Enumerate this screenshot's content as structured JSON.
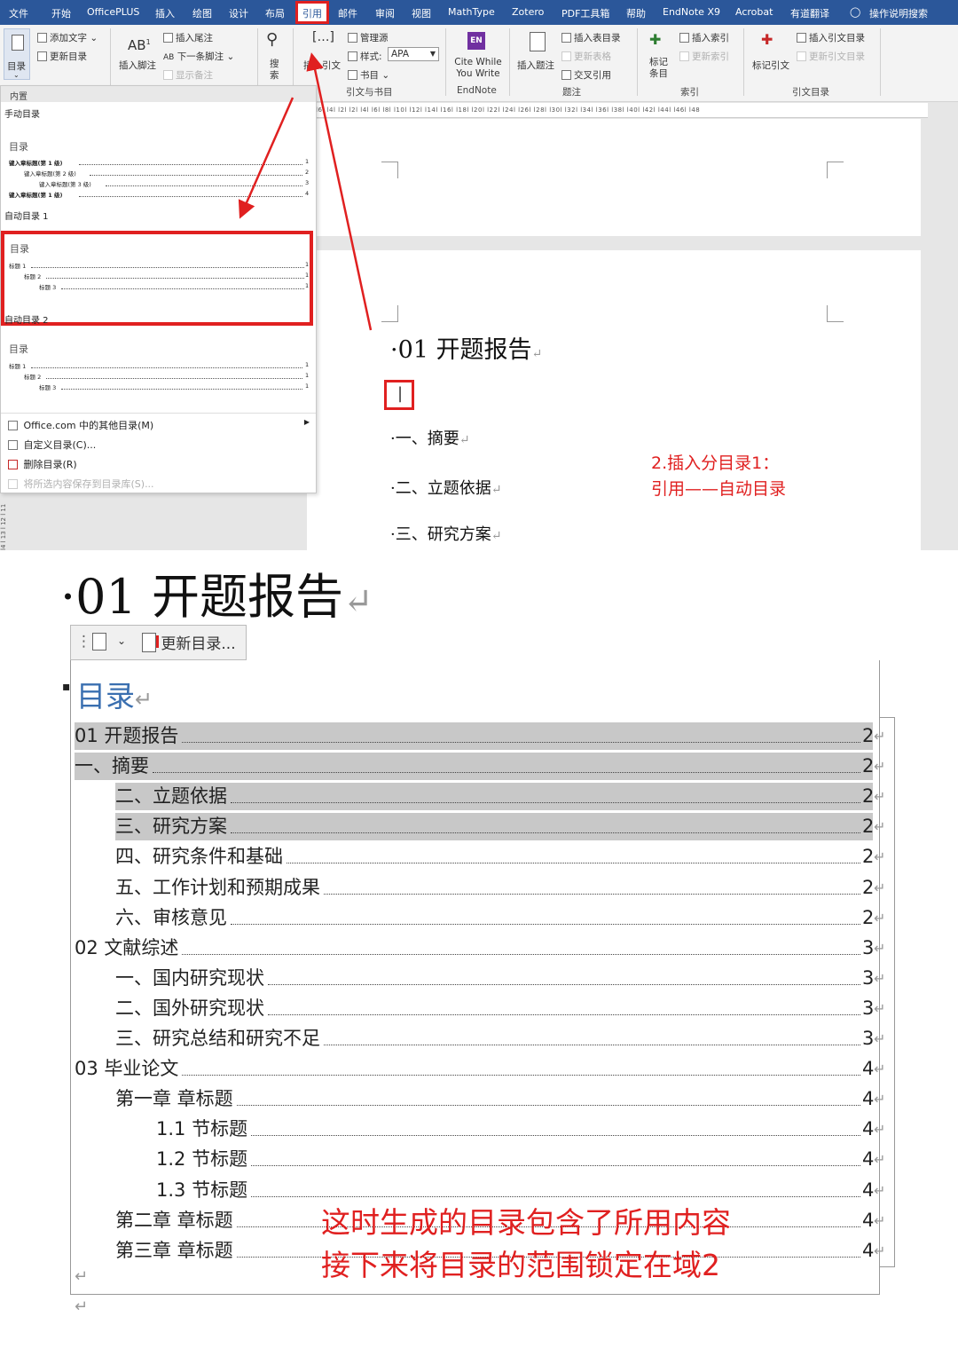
{
  "menubar": {
    "tabs": [
      "文件",
      "开始",
      "OfficePLUS",
      "插入",
      "绘图",
      "设计",
      "布局",
      "引用",
      "邮件",
      "审阅",
      "视图",
      "MathType",
      "Zotero",
      "PDF工具箱",
      "帮助",
      "EndNote X9",
      "Acrobat",
      "有道翻译",
      "操作说明搜索"
    ]
  },
  "ribbon": {
    "toc_button": "目录",
    "add_text": "添加文字",
    "update_toc": "更新目录",
    "insert_footnote": "插入脚注",
    "insert_endnote": "插入尾注",
    "next_footnote": "下一条脚注",
    "show_notes": "显示备注",
    "search": "搜索",
    "insert_citation": "插入引文",
    "manage_sources": "管理源",
    "style_label": "样式:",
    "style_value": "APA",
    "bibliography": "书目",
    "group_citations": "引文与书目",
    "cite_while_you_write": "Cite While You Write",
    "endnote_icon": "EN",
    "group_endnote": "EndNote",
    "insert_caption": "插入题注",
    "insert_table_of_figures": "插入表目录",
    "update_table": "更新表格",
    "cross_reference": "交叉引用",
    "group_captions": "题注",
    "mark_entry": "标记条目",
    "insert_index": "插入索引",
    "update_index": "更新索引",
    "group_index": "索引",
    "mark_citation": "标记引文",
    "insert_table_of_authorities": "插入引文目录",
    "update_table_of_authorities": "更新引文目录",
    "group_authorities": "引文目录"
  },
  "ruler_text": "l6l  l4l  l2l   l2l  l4l  l6l  l8l  l10l  l12l  l14l  l16l  l18l  l20l  l22l  l24l  l26l  l28l  l30l  l32l  l34l  l36l  l38l  l40l  l42l  l44l  l46l  l48",
  "vruler_text": "l4 l 13 l 12 l 11",
  "dropdown": {
    "header": "内置",
    "manual_label": "手动目录",
    "manual_title": "目录",
    "manual_lines": [
      "键入章标题(第 1 级)",
      "键入章标题(第 2 级)",
      "键入章标题(第 3 级)",
      "键入章标题(第 1 级)"
    ],
    "manual_pages": [
      "1",
      "2",
      "3",
      "4"
    ],
    "auto1_label": "自动目录 1",
    "auto1_title": "目录",
    "auto1_lines": [
      "标题 1",
      "标题 2",
      "标题 3"
    ],
    "auto2_label": "自动目录 2",
    "auto2_title": "目录",
    "auto2_lines": [
      "标题 1",
      "标题 2",
      "标题 3"
    ],
    "line_page": "1",
    "menu_office": "Office.com 中的其他目录(M)",
    "menu_custom": "自定义目录(C)...",
    "menu_delete": "删除目录(R)",
    "menu_save": "将所选内容保存到目录库(S)..."
  },
  "document_top": {
    "heading": "·01 开题报告",
    "cursor": "|",
    "lines": [
      "·一、摘要",
      "·二、立题依据",
      "·三、研究方案"
    ],
    "para_mark": "↵",
    "annotation": [
      "2.插入分目录1：",
      "引用——自动目录"
    ]
  },
  "document_bottom": {
    "heading": "·01 开题报告",
    "toolbar_update": "更新目录...",
    "toc_title": "目录",
    "entries": [
      {
        "text": "01 开题报告",
        "page": "2"
      },
      {
        "text": "一、摘要",
        "page": "2"
      },
      {
        "text": "二、立题依据",
        "page": "2"
      },
      {
        "text": "三、研究方案",
        "page": "2"
      },
      {
        "text": "四、研究条件和基础",
        "page": "2"
      },
      {
        "text": "五、工作计划和预期成果",
        "page": "2"
      },
      {
        "text": "六、审核意见",
        "page": "2"
      },
      {
        "text": "02 文献综述",
        "page": "3"
      },
      {
        "text": "一、国内研究现状",
        "page": "3"
      },
      {
        "text": "二、国外研究现状",
        "page": "3"
      },
      {
        "text": "三、研究总结和研究不足",
        "page": "3"
      },
      {
        "text": "03 毕业论文",
        "page": "4"
      },
      {
        "text": "第一章  章标题",
        "page": "4"
      },
      {
        "text": "1.1 节标题",
        "page": "4"
      },
      {
        "text": "1.2 节标题",
        "page": "4"
      },
      {
        "text": "1.3 节标题",
        "page": "4"
      },
      {
        "text": "第二章  章标题",
        "page": "4"
      },
      {
        "text": "第三章  章标题",
        "page": "4"
      }
    ],
    "annotation": [
      "这时生成的目录包含了所用内容",
      "接下来将目录的范围锁定在域2"
    ]
  },
  "colors": {
    "accent": "#2b579a",
    "highlight_red": "#e02020",
    "toc_title_blue": "#3a6fb0",
    "selection_gray": "#c8c8c8"
  }
}
